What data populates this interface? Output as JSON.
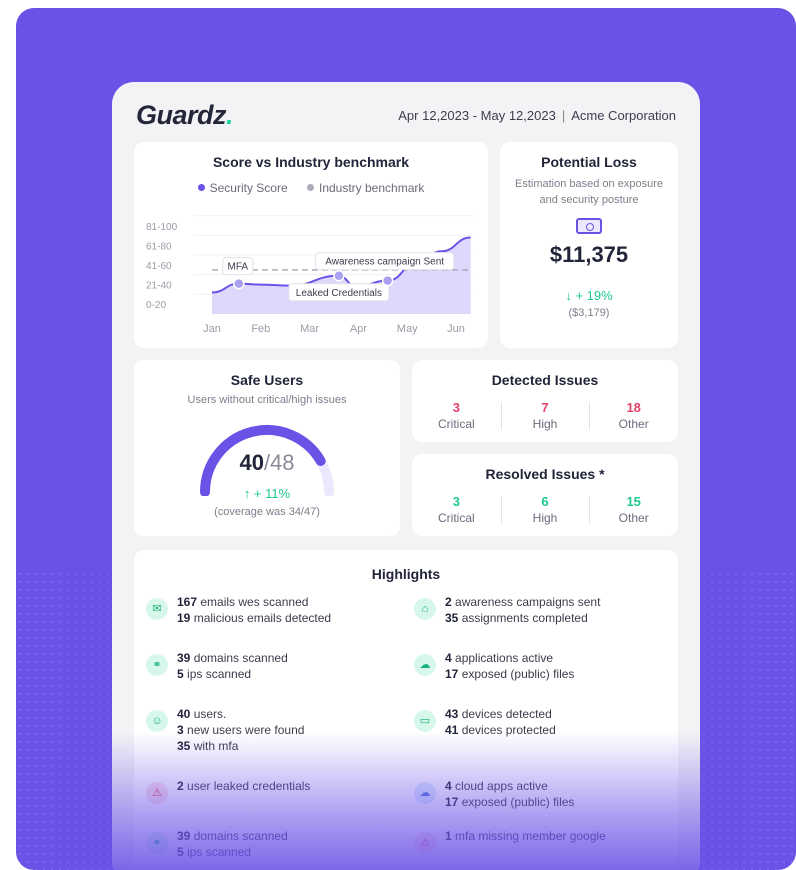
{
  "header": {
    "logo": "Guardz",
    "logo_dot": ".",
    "date_range": "Apr 12,2023 - May 12,2023",
    "separator": "|",
    "company": "Acme Corporation"
  },
  "score_card": {
    "title": "Score vs Industry benchmark",
    "legend_security": "Security Score",
    "legend_industry": "Industry benchmark",
    "annotations": [
      "MFA",
      "Leaked Credentials",
      "Awareness campaign Sent"
    ]
  },
  "chart_data": {
    "type": "line",
    "title": "Score vs Industry benchmark",
    "categories": [
      "Jan",
      "Feb",
      "Mar",
      "Apr",
      "May",
      "Jun"
    ],
    "y_categories": [
      "0-20",
      "21-40",
      "41-60",
      "61-80",
      "81-100"
    ],
    "series": [
      {
        "name": "Security Score",
        "values": [
          22,
          31,
          30,
          29,
          39,
          28,
          34,
          52,
          64,
          78
        ]
      },
      {
        "name": "Industry benchmark",
        "values": [
          45,
          45,
          45,
          45,
          45,
          45,
          45,
          45,
          45,
          45
        ]
      }
    ],
    "x_index": [
      0,
      0.55,
      1,
      1.6,
      2.6,
      2.95,
      3.6,
      4.2,
      4.7,
      5.3
    ],
    "ylim": [
      0,
      100
    ],
    "grid": true,
    "legend": "top",
    "colors": {
      "security": "#6b52e6",
      "industry": "#a9abb8",
      "area": "#d8d2fb"
    }
  },
  "potential_loss": {
    "title": "Potential Loss",
    "subtitle": "Estimation based on exposure and security posture",
    "icon": "money-icon",
    "amount": "$11,375",
    "delta": "↓  + 19%",
    "delta_sub": "($3,179)"
  },
  "safe_users": {
    "title": "Safe Users",
    "subtitle": "Users without critical/high issues",
    "value": "40",
    "total": "/48",
    "fraction": 0.833,
    "delta": "↑  + 11%",
    "coverage": "(coverage was 34/47)"
  },
  "detected_issues": {
    "title": "Detected Issues",
    "stats": [
      {
        "n": "3",
        "label": "Critical"
      },
      {
        "n": "7",
        "label": "High"
      },
      {
        "n": "18",
        "label": "Other"
      }
    ]
  },
  "resolved_issues": {
    "title": "Resolved Issues *",
    "stats": [
      {
        "n": "3",
        "label": "Critical"
      },
      {
        "n": "6",
        "label": "High"
      },
      {
        "n": "15",
        "label": "Other"
      }
    ]
  },
  "highlights": {
    "title": "Highlights",
    "items": [
      {
        "icon": "mail-icon",
        "lines": [
          [
            "167",
            " emails wes scanned"
          ],
          [
            "19",
            " malicious emails detected"
          ]
        ]
      },
      {
        "icon": "graduation-cap-icon",
        "lines": [
          [
            "2",
            " awareness campaigns sent"
          ],
          [
            "35",
            " assignments completed"
          ]
        ]
      },
      {
        "icon": "link-icon",
        "lines": [
          [
            "39",
            " domains scanned"
          ],
          [
            "5",
            " ips scanned"
          ]
        ]
      },
      {
        "icon": "cloud-icon",
        "lines": [
          [
            "4",
            " applications active"
          ],
          [
            "17",
            " exposed (public) files"
          ]
        ]
      },
      {
        "icon": "user-icon",
        "lines": [
          [
            "40",
            " users."
          ],
          [
            "3",
            " new users were found"
          ],
          [
            "35",
            " with mfa"
          ]
        ]
      },
      {
        "icon": "monitor-icon",
        "lines": [
          [
            "43",
            " devices detected"
          ],
          [
            "41",
            " devices protected"
          ]
        ]
      },
      {
        "icon": "warning-icon",
        "lines": [
          [
            "2",
            " user leaked credentials"
          ]
        ]
      },
      {
        "icon": "cloud-icon",
        "lines": [
          [
            "4",
            " cloud apps active"
          ],
          [
            "17",
            " exposed (public) files"
          ]
        ]
      },
      {
        "icon": "link-icon",
        "lines": [
          [
            "39",
            " domains scanned"
          ],
          [
            "5",
            " ips scanned"
          ]
        ]
      },
      {
        "icon": "warning-icon",
        "lines": [
          [
            "1",
            " mfa missing member google"
          ]
        ]
      }
    ]
  }
}
